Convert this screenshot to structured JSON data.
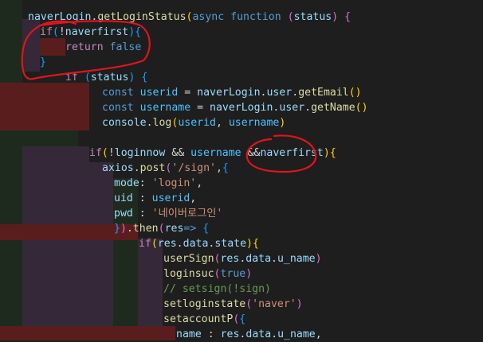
{
  "editor": {
    "theme_colors": {
      "background": "#1e1e1e",
      "function": "#dcdcaa",
      "control_keyword": "#c586c0",
      "storage_keyword": "#569cd6",
      "variable": "#9cdcfe",
      "constant": "#4fc1ff",
      "string": "#ce9178",
      "comment": "#6a9955",
      "punctuation": "#d4d4d4",
      "bracket_level_1": "#ffd700",
      "bracket_level_2": "#da70d6",
      "bracket_level_3": "#179fff",
      "indent_guide_red": "#5a1d1d",
      "indent_guide_green": "#1f2a1e",
      "indent_guide_purple": "#352838",
      "annotation_ink": "#e0141e"
    },
    "lines": [
      {
        "indent": 0,
        "tokens": [
          {
            "t": "naverLogin",
            "c": "var"
          },
          {
            "t": ".",
            "c": "p"
          },
          {
            "t": "getLoginStatus",
            "c": "fn"
          },
          {
            "t": "(",
            "c": "b1"
          },
          {
            "t": "async",
            "c": "st"
          },
          {
            "t": " ",
            "c": "p"
          },
          {
            "t": "function",
            "c": "st"
          },
          {
            "t": " ",
            "c": "p"
          },
          {
            "t": "(",
            "c": "b2"
          },
          {
            "t": "status",
            "c": "var"
          },
          {
            "t": ")",
            "c": "b2"
          },
          {
            "t": " ",
            "c": "p"
          },
          {
            "t": "{",
            "c": "b2"
          }
        ]
      },
      {
        "indent": 1,
        "tokens": [
          {
            "t": "if",
            "c": "kw"
          },
          {
            "t": "(",
            "c": "b3"
          },
          {
            "t": "!",
            "c": "p"
          },
          {
            "t": "naverfirst",
            "c": "var"
          },
          {
            "t": ")",
            "c": "b3"
          },
          {
            "t": "{",
            "c": "b3"
          }
        ]
      },
      {
        "indent": 2,
        "tokens": [
          {
            "t": "return",
            "c": "kw"
          },
          {
            "t": " ",
            "c": "p"
          },
          {
            "t": "false",
            "c": "st"
          }
        ]
      },
      {
        "indent": 1,
        "tokens": [
          {
            "t": "}",
            "c": "b3"
          }
        ]
      },
      {
        "indent": 2,
        "tokens": [
          {
            "t": "if",
            "c": "kw"
          },
          {
            "t": " ",
            "c": "p"
          },
          {
            "t": "(",
            "c": "b3"
          },
          {
            "t": "status",
            "c": "var"
          },
          {
            "t": ")",
            "c": "b3"
          },
          {
            "t": " ",
            "c": "p"
          },
          {
            "t": "{",
            "c": "b3"
          }
        ]
      },
      {
        "indent": 4,
        "tokens": [
          {
            "t": "const",
            "c": "st"
          },
          {
            "t": " ",
            "c": "p"
          },
          {
            "t": "userid",
            "c": "const"
          },
          {
            "t": " = ",
            "c": "p"
          },
          {
            "t": "naverLogin",
            "c": "var"
          },
          {
            "t": ".",
            "c": "p"
          },
          {
            "t": "user",
            "c": "var"
          },
          {
            "t": ".",
            "c": "p"
          },
          {
            "t": "getEmail",
            "c": "fn"
          },
          {
            "t": "()",
            "c": "b1"
          }
        ]
      },
      {
        "indent": 4,
        "tokens": [
          {
            "t": "const",
            "c": "st"
          },
          {
            "t": " ",
            "c": "p"
          },
          {
            "t": "username",
            "c": "const"
          },
          {
            "t": " = ",
            "c": "p"
          },
          {
            "t": "naverLogin",
            "c": "var"
          },
          {
            "t": ".",
            "c": "p"
          },
          {
            "t": "user",
            "c": "var"
          },
          {
            "t": ".",
            "c": "p"
          },
          {
            "t": "getName",
            "c": "fn"
          },
          {
            "t": "()",
            "c": "b1"
          }
        ]
      },
      {
        "indent": 4,
        "tokens": [
          {
            "t": "console",
            "c": "var"
          },
          {
            "t": ".",
            "c": "p"
          },
          {
            "t": "log",
            "c": "fn"
          },
          {
            "t": "(",
            "c": "b1"
          },
          {
            "t": "userid",
            "c": "const"
          },
          {
            "t": ", ",
            "c": "p"
          },
          {
            "t": "username",
            "c": "const"
          },
          {
            "t": ")",
            "c": "b1"
          }
        ]
      },
      {
        "indent": 0,
        "tokens": []
      },
      {
        "indent": 3,
        "tokens": [
          {
            "t": "if",
            "c": "kw"
          },
          {
            "t": "(",
            "c": "b1"
          },
          {
            "t": "!",
            "c": "p"
          },
          {
            "t": "loginnow",
            "c": "var"
          },
          {
            "t": " && ",
            "c": "p"
          },
          {
            "t": "username",
            "c": "const"
          },
          {
            "t": " &&",
            "c": "p"
          },
          {
            "t": "naverfirst",
            "c": "var"
          },
          {
            "t": ")",
            "c": "b1"
          },
          {
            "t": "{",
            "c": "b1"
          }
        ]
      },
      {
        "indent": 4,
        "tokens": [
          {
            "t": "axios",
            "c": "var"
          },
          {
            "t": ".",
            "c": "p"
          },
          {
            "t": "post",
            "c": "fn"
          },
          {
            "t": "(",
            "c": "b2"
          },
          {
            "t": "'/sign'",
            "c": "str"
          },
          {
            "t": ",",
            "c": "p"
          },
          {
            "t": "{",
            "c": "b3"
          }
        ]
      },
      {
        "indent": 5,
        "tokens": [
          {
            "t": "mode",
            "c": "var"
          },
          {
            "t": ": ",
            "c": "p"
          },
          {
            "t": "'login'",
            "c": "str"
          },
          {
            "t": ",",
            "c": "p"
          }
        ]
      },
      {
        "indent": 5,
        "tokens": [
          {
            "t": "uid",
            "c": "var"
          },
          {
            "t": " : ",
            "c": "p"
          },
          {
            "t": "userid",
            "c": "const"
          },
          {
            "t": ",",
            "c": "p"
          }
        ]
      },
      {
        "indent": 5,
        "tokens": [
          {
            "t": "pwd",
            "c": "var"
          },
          {
            "t": " : ",
            "c": "p"
          },
          {
            "t": "'네이버로그인'",
            "c": "str"
          }
        ]
      },
      {
        "indent": 5,
        "tokens": [
          {
            "t": "}",
            "c": "b3"
          },
          {
            "t": ")",
            "c": "b2"
          },
          {
            "t": ".",
            "c": "p"
          },
          {
            "t": "then",
            "c": "fn"
          },
          {
            "t": "(",
            "c": "b2"
          },
          {
            "t": "res",
            "c": "var"
          },
          {
            "t": "=> ",
            "c": "st"
          },
          {
            "t": "{",
            "c": "b3"
          }
        ]
      },
      {
        "indent": 6,
        "tokens": [
          {
            "t": "if",
            "c": "kw"
          },
          {
            "t": "(",
            "c": "b1"
          },
          {
            "t": "res",
            "c": "var"
          },
          {
            "t": ".",
            "c": "p"
          },
          {
            "t": "data",
            "c": "var"
          },
          {
            "t": ".",
            "c": "p"
          },
          {
            "t": "state",
            "c": "var"
          },
          {
            "t": ")",
            "c": "b1"
          },
          {
            "t": "{",
            "c": "b1"
          }
        ]
      },
      {
        "indent": 7,
        "tokens": [
          {
            "t": "userSign",
            "c": "fn"
          },
          {
            "t": "(",
            "c": "b2"
          },
          {
            "t": "res",
            "c": "var"
          },
          {
            "t": ".",
            "c": "p"
          },
          {
            "t": "data",
            "c": "var"
          },
          {
            "t": ".",
            "c": "p"
          },
          {
            "t": "u_name",
            "c": "var"
          },
          {
            "t": ")",
            "c": "b2"
          }
        ]
      },
      {
        "indent": 7,
        "tokens": [
          {
            "t": "loginsuc",
            "c": "fn"
          },
          {
            "t": "(",
            "c": "b2"
          },
          {
            "t": "true",
            "c": "st"
          },
          {
            "t": ")",
            "c": "b2"
          }
        ]
      },
      {
        "indent": 7,
        "tokens": [
          {
            "t": "// setsign(!sign)",
            "c": "cm"
          }
        ]
      },
      {
        "indent": 7,
        "tokens": [
          {
            "t": "setloginstate",
            "c": "fn"
          },
          {
            "t": "(",
            "c": "b2"
          },
          {
            "t": "'naver'",
            "c": "str"
          },
          {
            "t": ")",
            "c": "b2"
          }
        ]
      },
      {
        "indent": 7,
        "tokens": [
          {
            "t": "setaccountP",
            "c": "fn"
          },
          {
            "t": "(",
            "c": "b2"
          },
          {
            "t": "{",
            "c": "b3"
          }
        ]
      },
      {
        "indent": 8,
        "tokens": [
          {
            "t": "name",
            "c": "var"
          },
          {
            "t": " : ",
            "c": "p"
          },
          {
            "t": "res",
            "c": "var"
          },
          {
            "t": ".",
            "c": "p"
          },
          {
            "t": "data",
            "c": "var"
          },
          {
            "t": ".",
            "c": "p"
          },
          {
            "t": "u_name",
            "c": "var"
          },
          {
            "t": ",",
            "c": "p"
          }
        ]
      }
    ]
  },
  "annotations": [
    {
      "name": "red-circle-if-block",
      "kind": "hand-drawn ellipse"
    },
    {
      "name": "red-circle-naverfirst",
      "kind": "hand-drawn ellipse"
    }
  ]
}
